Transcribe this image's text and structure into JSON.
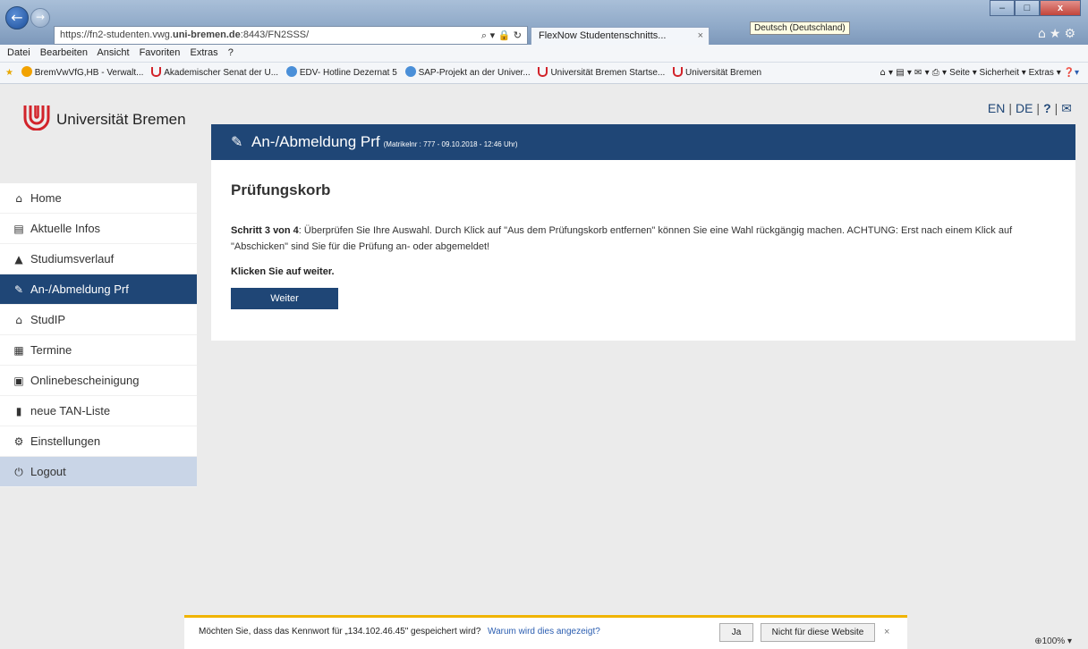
{
  "browser": {
    "url_prefix": "https://fn2-studenten.vwg.",
    "url_host": "uni-bremen.de",
    "url_suffix": ":8443/FN2SSS/",
    "tab_title": "FlexNow Studentenschnitts...",
    "lang_tooltip": "Deutsch (Deutschland)",
    "menu": [
      "Datei",
      "Bearbeiten",
      "Ansicht",
      "Favoriten",
      "Extras",
      "?"
    ],
    "favorites": [
      "BremVwVfG,HB - Verwalt...",
      "Akademischer Senat der U...",
      "EDV- Hotline Dezernat 5",
      "SAP-Projekt an der Univer...",
      "Universität Bremen Startse...",
      "Universität Bremen"
    ],
    "fav_tools": "Seite ▾   Sicherheit ▾   Extras ▾",
    "zoom": "100%"
  },
  "site": {
    "logo_text": "Universität Bremen",
    "lang_en": "EN",
    "lang_de": "DE",
    "help": "?",
    "colors": {
      "primary": "#1f4676",
      "logo_red": "#d2232a"
    }
  },
  "header": {
    "title": "An-/Abmeldung Prf",
    "meta": "(Matrikelnr : 777 - 09.10.2018 - 12:46 Uhr)"
  },
  "sidebar": {
    "items": [
      {
        "label": "Home",
        "icon": "home-icon"
      },
      {
        "label": "Aktuelle Infos",
        "icon": "news-icon"
      },
      {
        "label": "Studiumsverlauf",
        "icon": "graduation-cap-icon"
      },
      {
        "label": "An-/Abmeldung Prf",
        "icon": "edit-icon",
        "active": true
      },
      {
        "label": "StudIP",
        "icon": "institution-icon"
      },
      {
        "label": "Termine",
        "icon": "calendar-icon"
      },
      {
        "label": "Onlinebescheinigung",
        "icon": "certificate-icon"
      },
      {
        "label": "neue TAN-Liste",
        "icon": "file-icon"
      },
      {
        "label": "Einstellungen",
        "icon": "gear-icon"
      },
      {
        "label": "Logout",
        "icon": "power-icon"
      }
    ]
  },
  "main": {
    "heading": "Prüfungskorb",
    "step_label": "Schritt 3 von 4",
    "step_text": ": Überprüfen Sie Ihre Auswahl. Durch Klick auf \"Aus dem Prüfungskorb entfernen\" können Sie eine Wahl rückgängig machen. ACHTUNG: Erst nach einem Klick auf \"Abschicken\" sind Sie für die Prüfung an- oder abgemeldet!",
    "hint": "Klicken Sie auf weiter.",
    "button": "Weiter"
  },
  "notification": {
    "message": "Möchten Sie, dass das Kennwort für „134.102.46.45\" gespeichert wird?",
    "why": "Warum wird dies angezeigt?",
    "yes": "Ja",
    "no": "Nicht für diese Website"
  }
}
